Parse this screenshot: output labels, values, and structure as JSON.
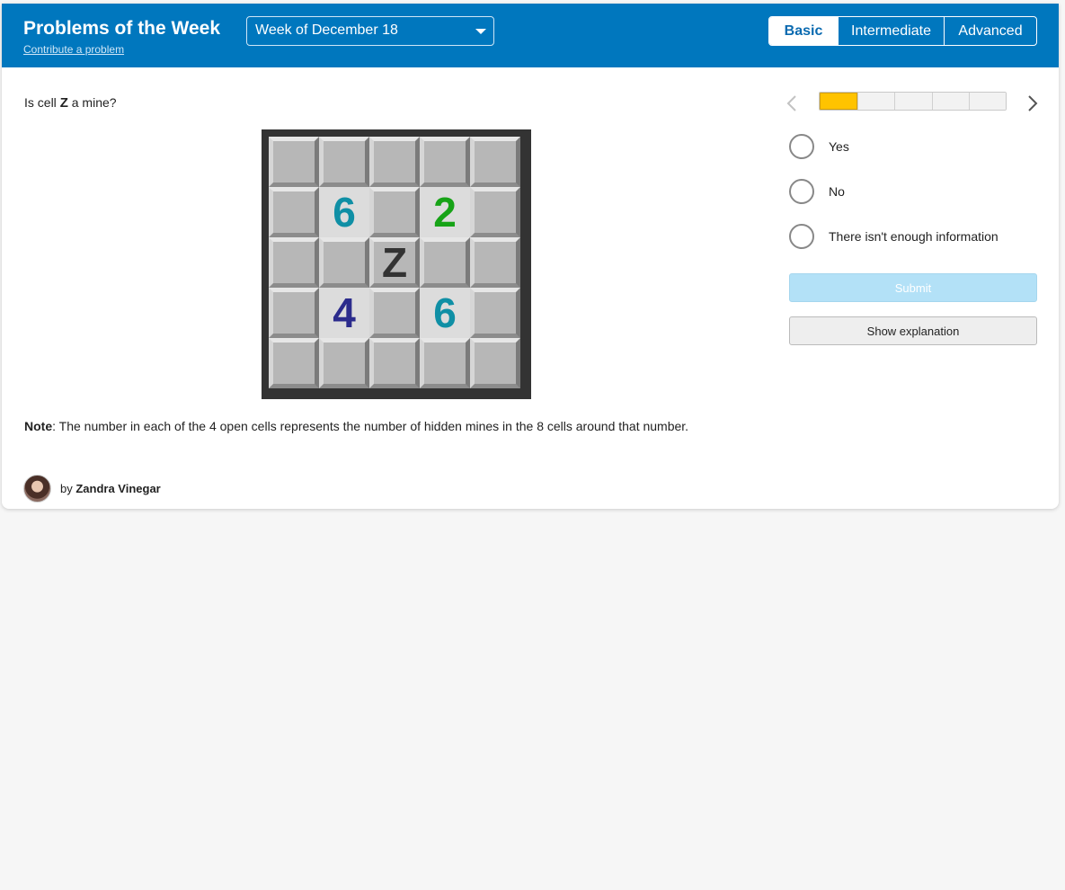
{
  "header": {
    "title": "Problems of the Week",
    "contribute_link": "Contribute a problem",
    "week_select": {
      "selected": "Week of December 18"
    },
    "levels": [
      {
        "label": "Basic",
        "active": true
      },
      {
        "label": "Intermediate",
        "active": false
      },
      {
        "label": "Advanced",
        "active": false
      }
    ]
  },
  "problem": {
    "question_prefix": "Is cell ",
    "question_var": "Z",
    "question_suffix": " a mine?",
    "board": [
      [
        "",
        "",
        "",
        "",
        ""
      ],
      [
        "",
        "6",
        "",
        "2",
        ""
      ],
      [
        "",
        "",
        "Z",
        "",
        ""
      ],
      [
        "",
        "4",
        "",
        "6",
        ""
      ],
      [
        "",
        "",
        "",
        "",
        ""
      ]
    ],
    "number_colors": {
      "6": "#0f8fa5",
      "2": "#17a317",
      "4": "#2b2b8c"
    },
    "note_label": "Note",
    "note_text": ": The number in each of the 4 open cells represents the number of hidden mines in the 8 cells around that number."
  },
  "author": {
    "by": "by ",
    "name": "Zandra Vinegar"
  },
  "progress": {
    "completed": 1,
    "total": 5
  },
  "nav": {
    "prev_icon": "chevron-left-icon",
    "next_icon": "chevron-right-icon"
  },
  "options": [
    {
      "label": "Yes"
    },
    {
      "label": "No"
    },
    {
      "label": "There isn't enough information"
    }
  ],
  "buttons": {
    "submit": "Submit",
    "explain": "Show explanation"
  },
  "colors": {
    "brand": "#0077be",
    "progress": "#ffc300",
    "submit_disabled": "#b3e1f7"
  }
}
